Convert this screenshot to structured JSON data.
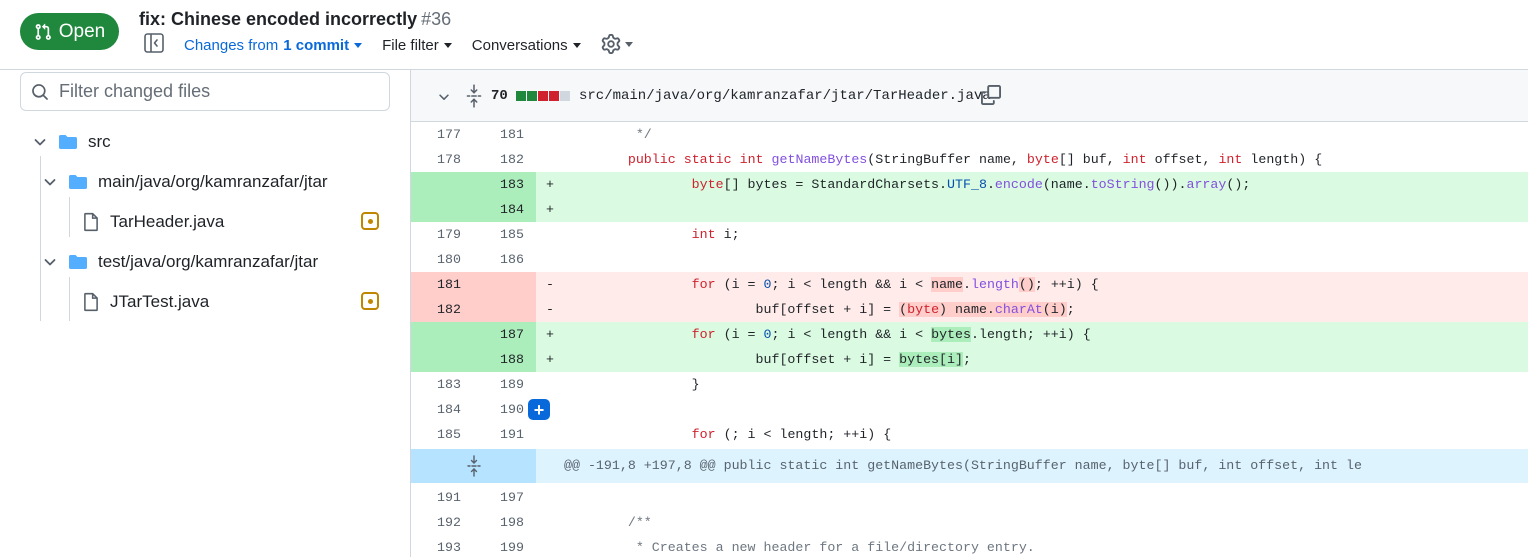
{
  "header": {
    "status_label": "Open",
    "title": "fix: Chinese encoded incorrectly",
    "number": "#36",
    "changes_prefix": "Changes from",
    "changes_count": "1 commit",
    "file_filter": "File filter",
    "conversations": "Conversations"
  },
  "sidebar": {
    "filter_placeholder": "Filter changed files",
    "tree": [
      {
        "label": "src",
        "type": "folder"
      },
      {
        "label": "main/java/org/kamranzafar/jtar",
        "type": "folder"
      },
      {
        "label": "TarHeader.java",
        "type": "file",
        "status": "modified"
      },
      {
        "label": "test/java/org/kamranzafar/jtar",
        "type": "folder"
      },
      {
        "label": "JTarTest.java",
        "type": "file",
        "status": "modified"
      }
    ]
  },
  "diff": {
    "file": {
      "changed_count": "70",
      "diffstat": [
        "add",
        "add",
        "del",
        "del",
        "neutral"
      ],
      "path": "src/main/java/org/kamranzafar/jtar/TarHeader.java"
    },
    "lines": [
      {
        "old": "177",
        "new": "181",
        "type": "ctx",
        "marker": "",
        "code": "         */"
      },
      {
        "old": "178",
        "new": "182",
        "type": "ctx",
        "marker": "",
        "code": "        public static int getNameBytes(StringBuffer name, byte[] buf, int offset, int length) {"
      },
      {
        "old": "",
        "new": "183",
        "type": "add",
        "marker": "+",
        "code": "                byte[] bytes = StandardCharsets.UTF_8.encode(name.toString()).array();"
      },
      {
        "old": "",
        "new": "184",
        "type": "add",
        "marker": "+",
        "code": ""
      },
      {
        "old": "179",
        "new": "185",
        "type": "ctx",
        "marker": "",
        "code": "                int i;"
      },
      {
        "old": "180",
        "new": "186",
        "type": "ctx",
        "marker": "",
        "code": ""
      },
      {
        "old": "181",
        "new": "",
        "type": "del",
        "marker": "-",
        "code": "                for (i = 0; i < length && i < name.length(); ++i) {"
      },
      {
        "old": "182",
        "new": "",
        "type": "del",
        "marker": "-",
        "code": "                        buf[offset + i] = (byte) name.charAt(i);"
      },
      {
        "old": "",
        "new": "187",
        "type": "add",
        "marker": "+",
        "code": "                for (i = 0; i < length && i < bytes.length; ++i) {"
      },
      {
        "old": "",
        "new": "188",
        "type": "add",
        "marker": "+",
        "code": "                        buf[offset + i] = bytes[i];"
      },
      {
        "old": "183",
        "new": "189",
        "type": "ctx",
        "marker": "",
        "code": "                }"
      },
      {
        "old": "184",
        "new": "190",
        "type": "ctx",
        "marker": "",
        "code": ""
      },
      {
        "old": "185",
        "new": "191",
        "type": "ctx",
        "marker": "",
        "code": "                for (; i < length; ++i) {"
      }
    ],
    "hunk_header": "@@ -191,8 +197,8 @@ public static int getNameBytes(StringBuffer name, byte[] buf, int offset, int le",
    "after_lines": [
      {
        "old": "191",
        "new": "197",
        "type": "ctx",
        "marker": "",
        "code": ""
      },
      {
        "old": "192",
        "new": "198",
        "type": "ctx",
        "marker": "",
        "code": "        /**"
      },
      {
        "old": "193",
        "new": "199",
        "type": "ctx",
        "marker": "",
        "code": "         * Creates a new header for a file/directory entry."
      }
    ],
    "add_comment_label": "+"
  },
  "colors": {
    "open_green": "#1f883d",
    "link_blue": "#0969da",
    "add_bg": "#dafbe1",
    "del_bg": "#ffebe9",
    "hunk_bg": "#ddf4ff",
    "modified": "#bf8700"
  },
  "icons": [
    "pull-request-icon",
    "sidebar-toggle-icon",
    "gear-icon",
    "search-icon",
    "chevron-down-icon",
    "folder-icon",
    "file-icon",
    "file-modified-icon",
    "unfold-icon",
    "copy-icon"
  ]
}
